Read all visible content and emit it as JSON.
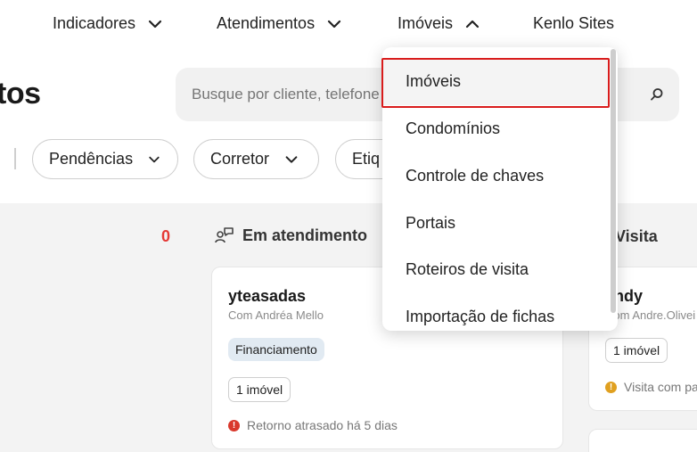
{
  "nav": {
    "indicadores": "Indicadores",
    "atendimentos": "Atendimentos",
    "imoveis": "Imóveis",
    "kenlo_sites": "Kenlo Sites"
  },
  "page": {
    "title": "tos"
  },
  "search": {
    "placeholder": "Busque por cliente, telefone"
  },
  "filters": {
    "pendencias": "Pendências",
    "corretor": "Corretor",
    "etiquetas": "Etiq"
  },
  "board": {
    "col1_count": "0",
    "col2_title": "Em atendimento",
    "col3_title": "Visita"
  },
  "cards": {
    "card1": {
      "title": "yteasadas",
      "subtitle": "Com Andréa Mello",
      "tag": "Financiamento",
      "properties": "1 imóvel",
      "note": "Retorno atrasado há 5 dias"
    },
    "card2": {
      "title": "andy",
      "subtitle": "Com Andre.Olivei",
      "properties": "1 imóvel",
      "note": "Visita com pa"
    }
  },
  "dropdown": {
    "items": [
      "Imóveis",
      "Condomínios",
      "Controle de chaves",
      "Portais",
      "Roteiros de visita",
      "Importação de fichas"
    ],
    "active_index": 0
  },
  "colors": {
    "accent_red": "#d91c1c",
    "count_red": "#e53935",
    "tag_bg": "#e1eaf2",
    "warning_red": "#d9382c",
    "warning_orange": "#e0a020"
  }
}
